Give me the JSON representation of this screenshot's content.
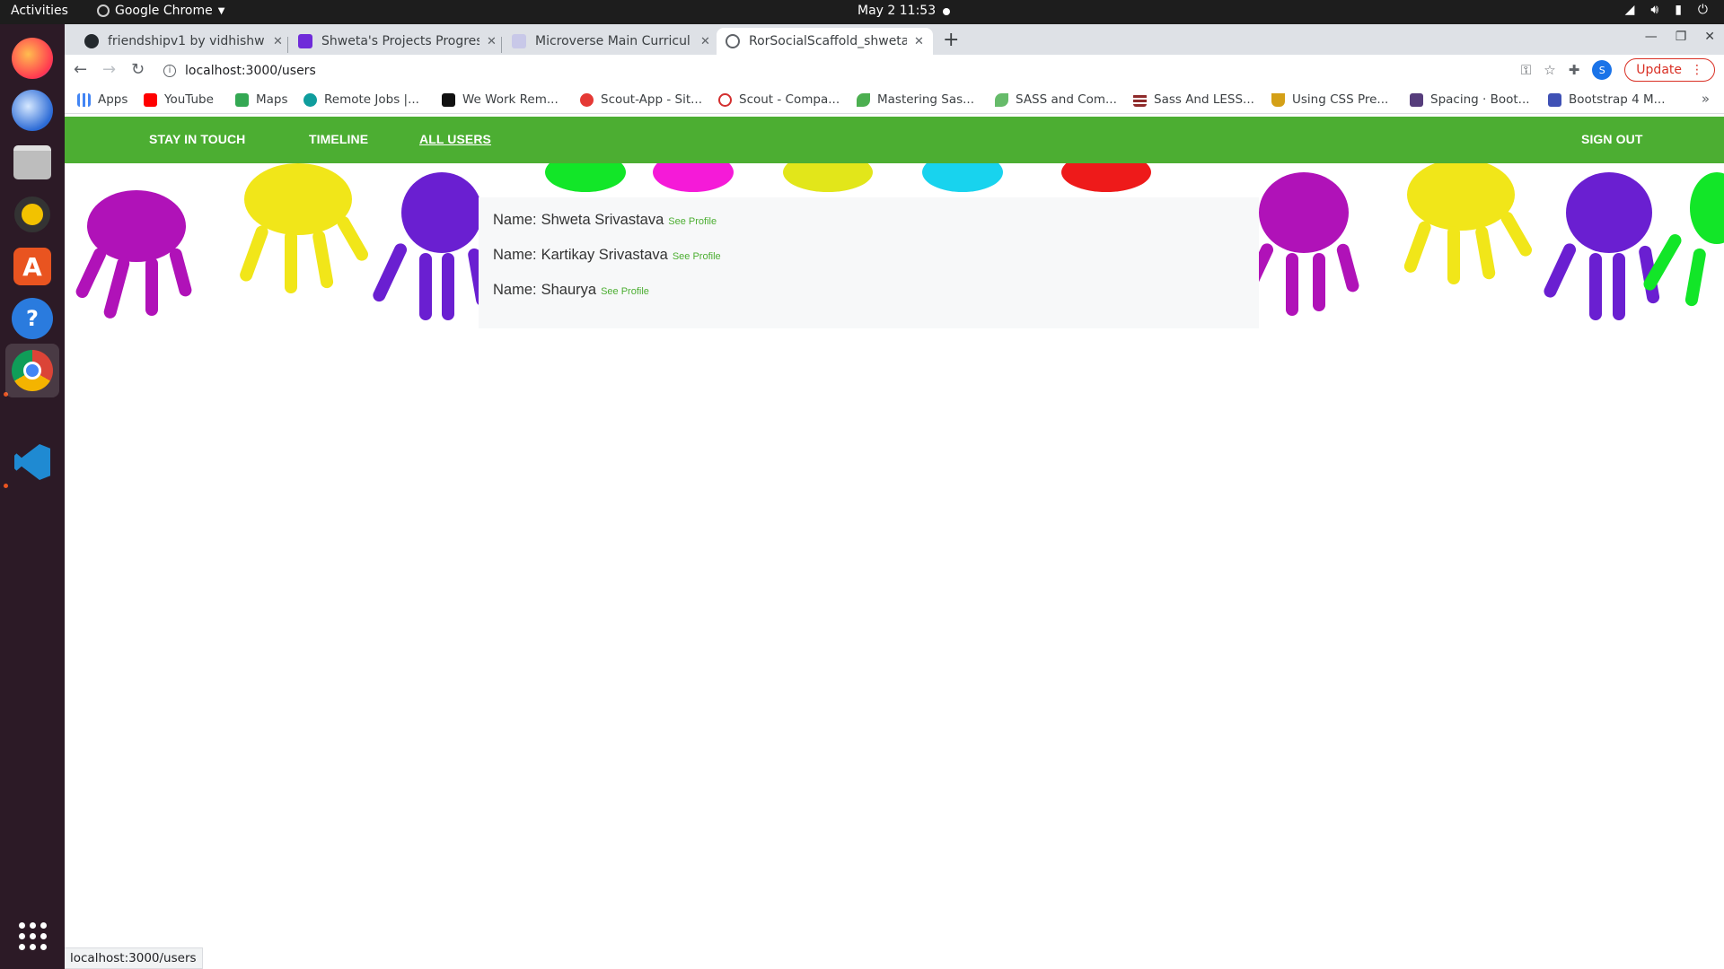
{
  "topbar": {
    "activities": "Activities",
    "app_name": "Google Chrome",
    "clock": "May 2  11:53"
  },
  "dock": {
    "icons": [
      "firefox-icon",
      "thunderbird-icon",
      "files-icon",
      "rhythmbox-icon",
      "software-icon",
      "help-icon",
      "chrome-icon",
      "vscode-icon",
      "show-apps-icon"
    ]
  },
  "browser": {
    "tabs": [
      {
        "title": "friendshipv1 by vidhishw",
        "favicon": "github-icon",
        "color": "#24292e"
      },
      {
        "title": "Shweta's Projects Progres",
        "favicon": "microverse-icon",
        "color": "#6f2bd9"
      },
      {
        "title": "Microverse Main Curricul",
        "favicon": "microverse-icon",
        "color": "#c8c8e8"
      },
      {
        "title": "RorSocialScaffold_shweta",
        "favicon": "globe-icon",
        "color": "#5f6368",
        "active": true
      }
    ],
    "url": "localhost:3000/users",
    "update_label": "Update",
    "profile_initial": "S",
    "bookmarks": [
      {
        "label": "Apps",
        "icon": "apps-grid-icon",
        "color": "#4285f4"
      },
      {
        "label": "YouTube",
        "icon": "youtube-icon",
        "color": "#ff0000"
      },
      {
        "label": "Maps",
        "icon": "maps-icon",
        "color": "#34a853"
      },
      {
        "label": "Remote Jobs |...",
        "icon": "remote-jobs-icon",
        "color": "#0f9d9d"
      },
      {
        "label": "We Work Rem...",
        "icon": "wework-icon",
        "color": "#111111"
      },
      {
        "label": "Scout-App - Sit...",
        "icon": "scout-icon",
        "color": "#e53935"
      },
      {
        "label": "Scout - Compa...",
        "icon": "scout-compass-icon",
        "color": "#d32f2f"
      },
      {
        "label": "Mastering Sas...",
        "icon": "leaf-icon",
        "color": "#4caf50"
      },
      {
        "label": "SASS and Com...",
        "icon": "leaf-icon",
        "color": "#66bb6a"
      },
      {
        "label": "Sass And LESS...",
        "icon": "grid-icon",
        "color": "#8e2a2a"
      },
      {
        "label": "Using CSS Pre...",
        "icon": "trophy-icon",
        "color": "#d4a017"
      },
      {
        "label": "Spacing · Boot...",
        "icon": "bootstrap-icon",
        "color": "#563d7c"
      },
      {
        "label": "Bootstrap 4 M...",
        "icon": "bookmark-icon",
        "color": "#3f51b5"
      }
    ]
  },
  "site": {
    "nav": {
      "stay_in_touch": "STAY IN TOUCH",
      "timeline": "TIMELINE",
      "all_users": "ALL USERS",
      "sign_out": "SIGN OUT"
    },
    "accent": "#4cae32",
    "users": [
      {
        "label": "Name:",
        "name": "Shweta Srivastava",
        "link": "See Profile"
      },
      {
        "label": "Name:",
        "name": "Kartikay Srivastava",
        "link": "See Profile"
      },
      {
        "label": "Name:",
        "name": "Shaurya",
        "link": "See Profile"
      }
    ]
  },
  "statusbar": "localhost:3000/users"
}
